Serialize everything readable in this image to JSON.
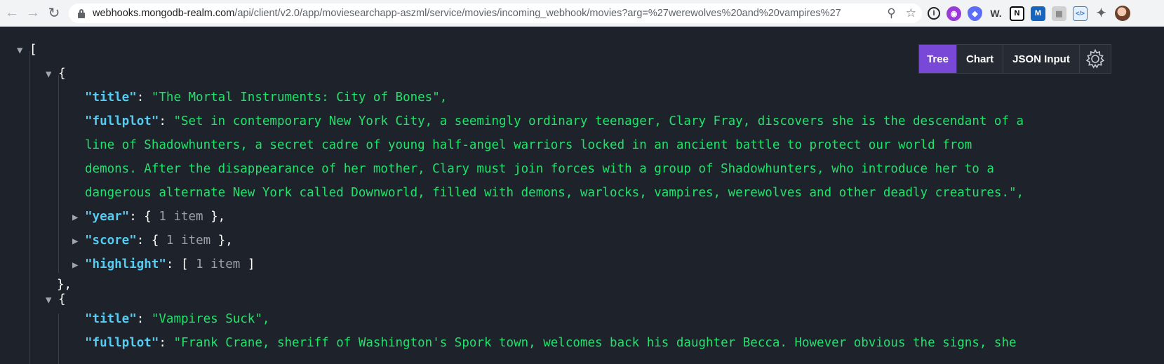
{
  "browser": {
    "url_host": "webhooks.mongodb-realm.com",
    "url_path": "/api/client/v2.0/app/moviesearchapp-aszml/service/movies/incoming_webhook/movies?arg=%27werewolves%20and%20vampires%27",
    "back_icon": "arrow-left",
    "forward_icon": "arrow-right",
    "reload_icon": "reload",
    "zoom_icon": "magnifier-zoom",
    "bookmark_icon": "star",
    "extensions": [
      {
        "name": "info",
        "symbol": "i",
        "color": "#202124"
      },
      {
        "name": "purple-face",
        "symbol": "◉",
        "color": "#8e44ad"
      },
      {
        "name": "shield",
        "symbol": "◆",
        "color": "#5b6ef5"
      },
      {
        "name": "w",
        "symbol": "W.",
        "color": "#3b3b3b"
      },
      {
        "name": "notion",
        "symbol": "N",
        "color": "#000000"
      },
      {
        "name": "m",
        "symbol": "M",
        "color": "#1e88e5"
      },
      {
        "name": "grey-box",
        "symbol": "▦",
        "color": "#c8c8c8"
      },
      {
        "name": "code",
        "symbol": "</>",
        "color": "#4a90e2"
      },
      {
        "name": "puzzle",
        "symbol": "✦",
        "color": "#5f6368"
      }
    ]
  },
  "toolbar": {
    "tree_label": "Tree",
    "chart_label": "Chart",
    "json_input_label": "JSON Input",
    "gear_symbol": "⚙"
  },
  "json": {
    "open_bracket": "[",
    "open_brace": "{",
    "item1": {
      "title_key": "\"title\"",
      "title_value": "\"The Mortal Instruments: City of Bones\",",
      "fullplot_key": "\"fullplot\"",
      "fullplot_lines": [
        "\"Set in contemporary New York City, a seemingly ordinary teenager, Clary Fray, discovers she is the descendant of a",
        "line of Shadowhunters, a secret cadre of young half-angel warriors locked in an ancient battle to protect our world from",
        "demons. After the disappearance of her mother, Clary must join forces with a group of Shadowhunters, who introduce her to a",
        "dangerous alternate New York called Downworld, filled with demons, warlocks, vampires, werewolves and other deadly creatures.\","
      ],
      "year_key": "\"year\"",
      "score_key": "\"score\"",
      "highlight_key": "\"highlight\"",
      "one_item": "1 item",
      "close": "},"
    },
    "item2": {
      "title_key": "\"title\"",
      "title_value": "\"Vampires Suck\",",
      "fullplot_key": "\"fullplot\"",
      "fullplot_line": "\"Frank Crane, sheriff of Washington's Spork town, welcomes back his daughter Becca. However obvious the signs, she"
    }
  }
}
